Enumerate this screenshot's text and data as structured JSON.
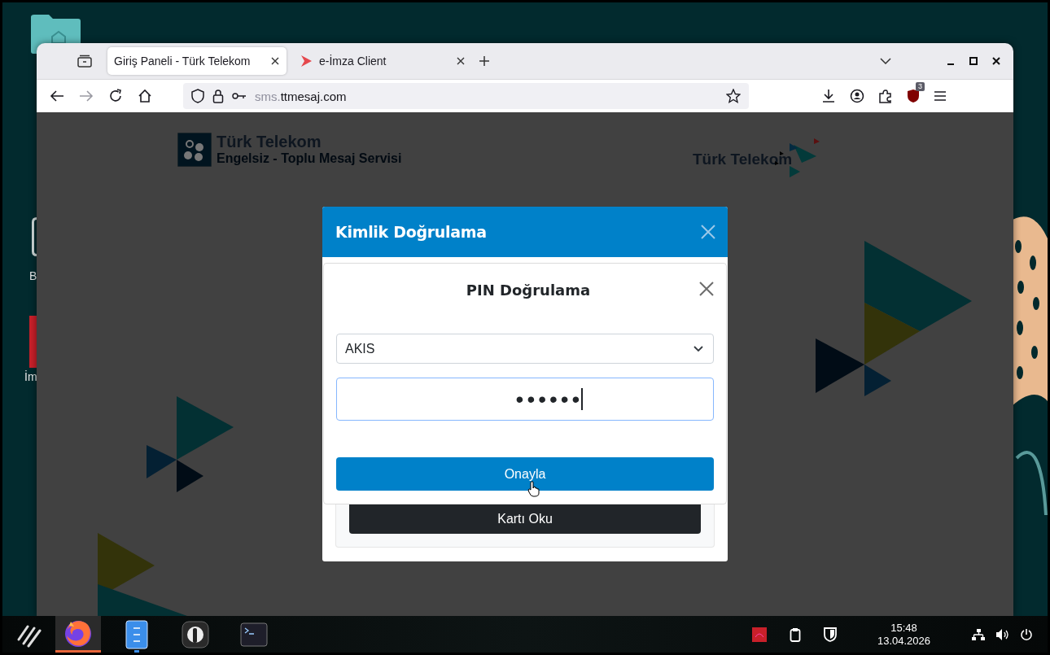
{
  "desktop": {
    "icons": [
      {
        "kind": "folder"
      },
      {
        "kind": "device",
        "label": "B"
      },
      {
        "kind": "app",
        "label": "İm"
      }
    ]
  },
  "browser": {
    "tabs": [
      {
        "title": "Giriş Paneli - Türk Telekom",
        "selected": true,
        "kind": "page"
      },
      {
        "title": "e-İmza Client",
        "selected": false,
        "kind": "app"
      }
    ],
    "url": {
      "prefix": "sms.",
      "domain": "ttmesaj.com"
    },
    "extension_badge": "3"
  },
  "page": {
    "header_logo": {
      "brand": "Türk Telekom",
      "subtitle": "Engelsiz - Toplu Mesaj Servisi"
    },
    "corner_logo": "Türk Telekom"
  },
  "modal": {
    "title": "Kimlik Doğrulama",
    "pin_dialog": {
      "title": "PIN Doğrulama",
      "reader": "AKIS",
      "pin_mask": "••••••",
      "confirm_button": "Onayla"
    },
    "read_card_button": "Kartı Oku"
  },
  "taskbar": {
    "apps": [
      {
        "kind": "firefox",
        "selected": true,
        "running": true
      },
      {
        "kind": "files",
        "selected": false,
        "running": true
      },
      {
        "kind": "pass",
        "selected": false,
        "running": false
      },
      {
        "kind": "terminal",
        "selected": false,
        "running": false
      }
    ],
    "clock": {
      "time": "15:48",
      "date": "13.04.2026"
    }
  }
}
